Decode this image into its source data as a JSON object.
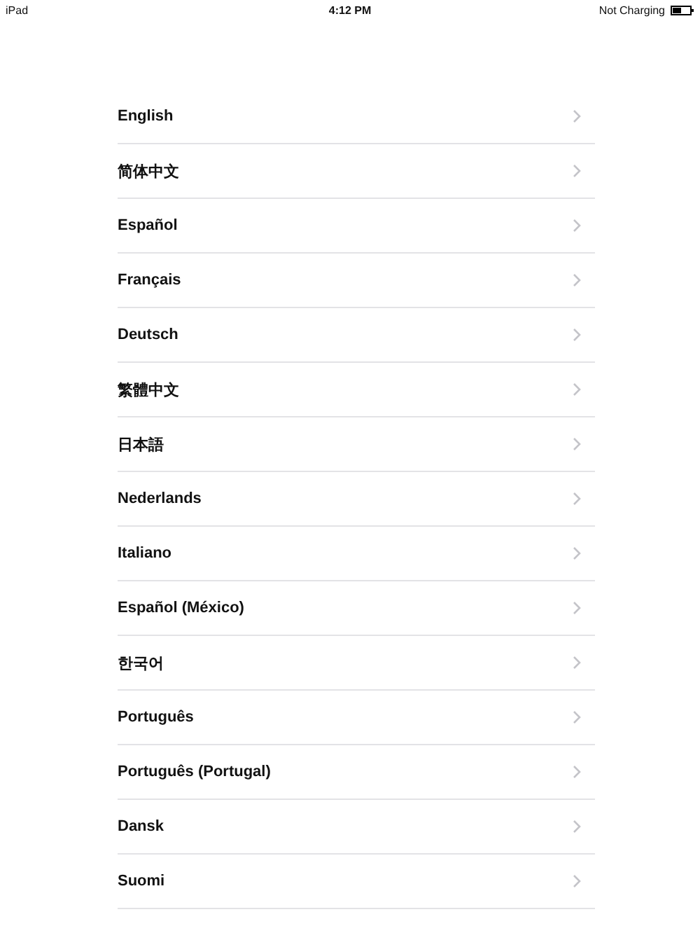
{
  "status_bar": {
    "device": "iPad",
    "time": "4:12 PM",
    "charging": "Not Charging"
  },
  "languages": [
    {
      "label": "English"
    },
    {
      "label": "简体中文"
    },
    {
      "label": "Español"
    },
    {
      "label": "Français"
    },
    {
      "label": "Deutsch"
    },
    {
      "label": "繁體中文"
    },
    {
      "label": "日本語"
    },
    {
      "label": "Nederlands"
    },
    {
      "label": "Italiano"
    },
    {
      "label": "Español (México)"
    },
    {
      "label": "한국어"
    },
    {
      "label": "Português"
    },
    {
      "label": "Português (Portugal)"
    },
    {
      "label": "Dansk"
    },
    {
      "label": "Suomi"
    }
  ]
}
